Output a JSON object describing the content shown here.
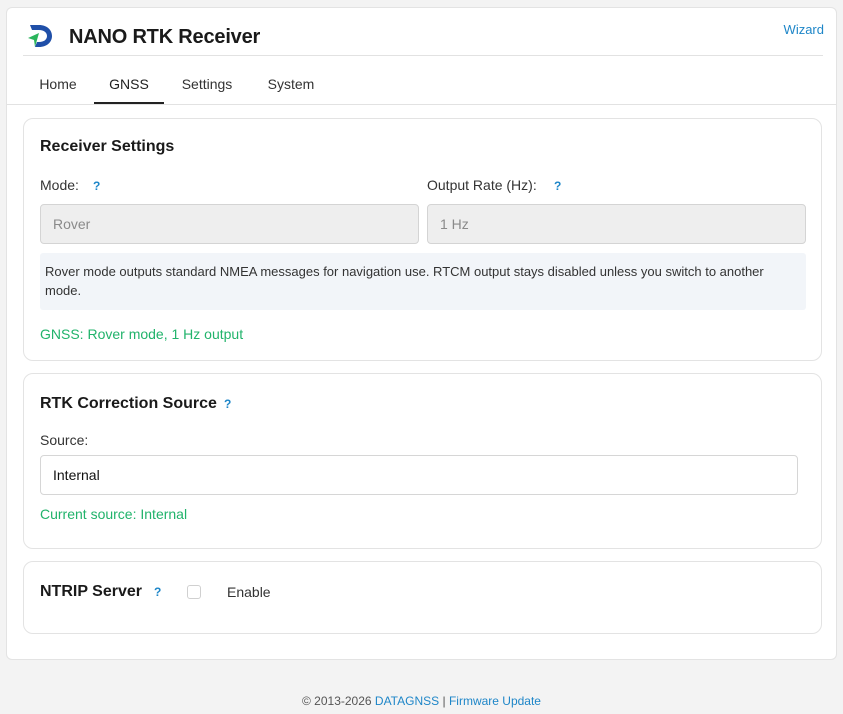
{
  "header": {
    "title": "NANO RTK Receiver",
    "logo_icon": "datagnss-logo-icon",
    "wizard_label": "Wizard"
  },
  "tabs": [
    {
      "label": "Home",
      "active": false
    },
    {
      "label": "GNSS",
      "active": true
    },
    {
      "label": "Settings",
      "active": false
    },
    {
      "label": "System",
      "active": false
    }
  ],
  "receiver_settings": {
    "title": "Receiver Settings",
    "mode_label": "Mode:",
    "mode_help": "?",
    "mode_value": "Rover",
    "rate_label": "Output Rate (Hz):",
    "rate_help": "?",
    "rate_value": "1 Hz",
    "info": "Rover mode outputs standard NMEA messages for navigation use. RTCM output stays disabled unless you switch to another mode.",
    "status": "GNSS: Rover mode, 1 Hz output"
  },
  "rtk_correction": {
    "title": "RTK Correction Source",
    "help": "?",
    "source_label": "Source:",
    "source_value": "Internal",
    "status": "Current source: Internal"
  },
  "ntrip_server": {
    "title": "NTRIP Server",
    "help": "?",
    "enable_label": "Enable",
    "enabled": false
  },
  "footer": {
    "copyright": "© 2013-2026",
    "brand_link": "DATAGNSS",
    "separator": "|",
    "firmware_link": "Firmware Update"
  },
  "colors": {
    "accent": "#1e86c8",
    "status_green": "#21b36b",
    "logo_blue": "#1f4fa8",
    "logo_green": "#2bb55c"
  }
}
